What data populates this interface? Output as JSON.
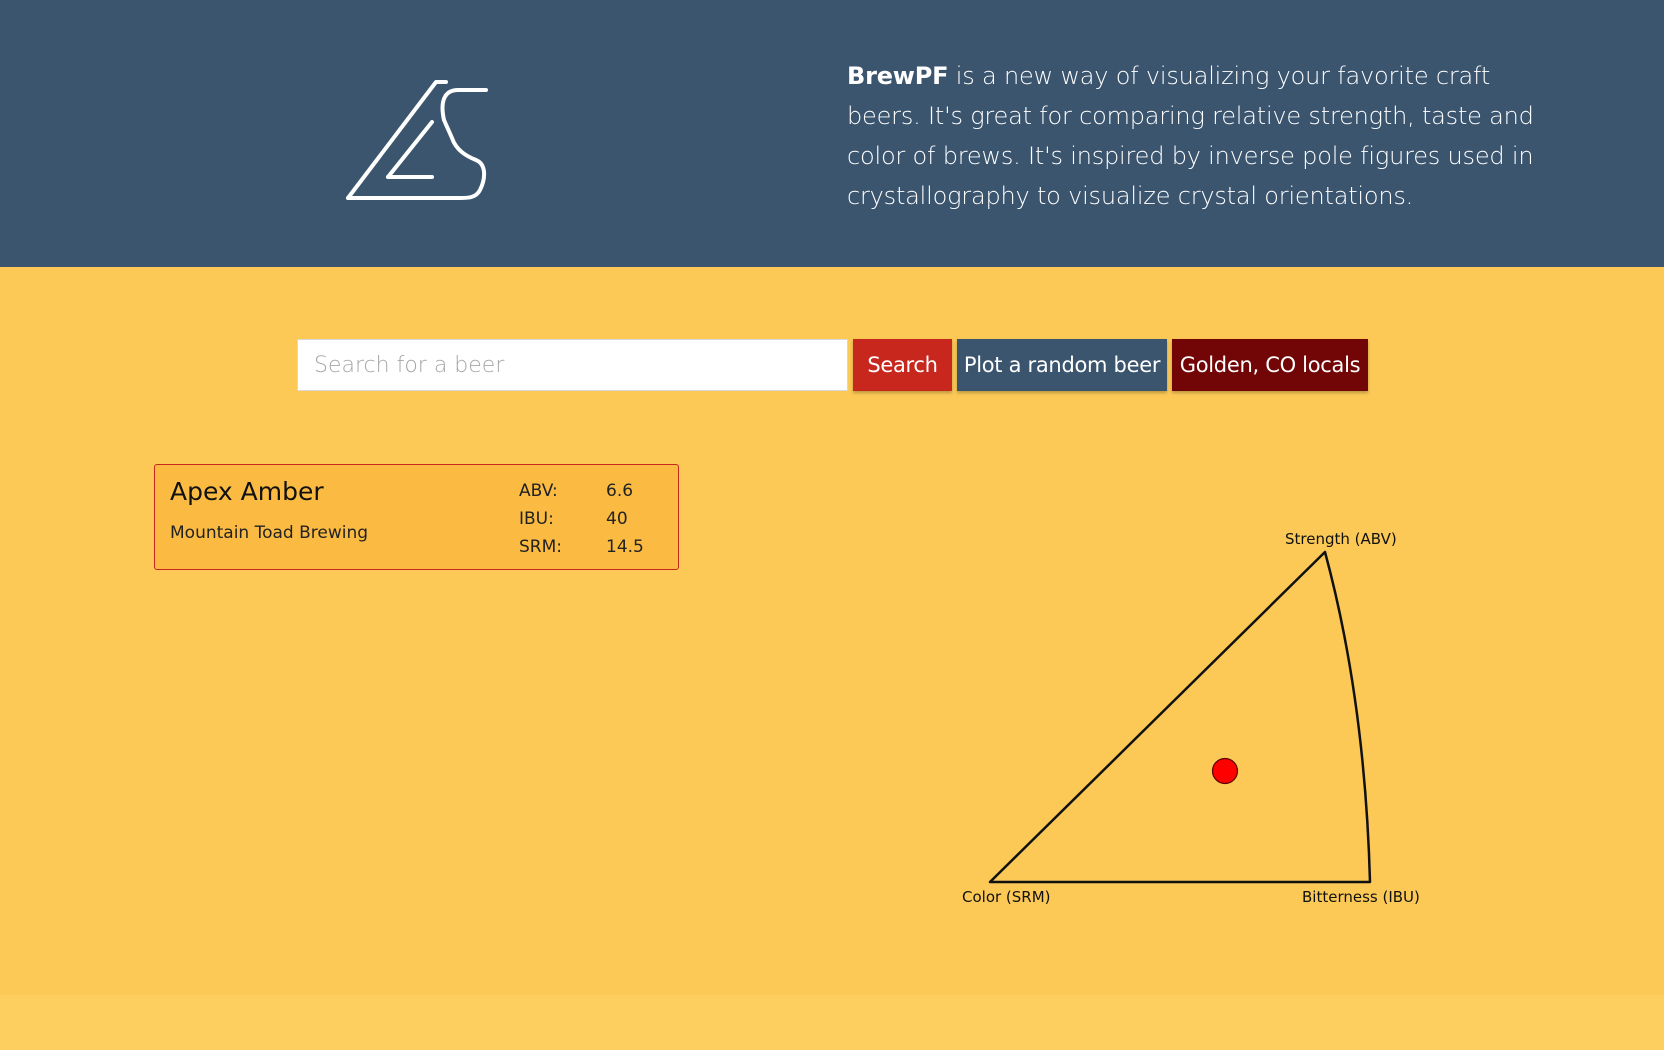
{
  "header": {
    "logo_name": "brewpf-logo",
    "intro": {
      "brand": "BrewPF",
      "text": " is a new way of visualizing your favorite craft beers. It's great for comparing relative strength, taste and color of brews. It's inspired by inverse pole figures used in crystallography to visualize crystal orientations."
    }
  },
  "search": {
    "placeholder": "Search for a beer",
    "value": "",
    "search_label": "Search",
    "random_label": "Plot a random beer",
    "locals_label": "Golden, CO locals"
  },
  "beer": {
    "name": "Apex Amber",
    "brewery": "Mountain Toad Brewing",
    "stats": [
      {
        "key": "ABV:",
        "value": "6.6"
      },
      {
        "key": "IBU:",
        "value": "40"
      },
      {
        "key": "SRM:",
        "value": "14.5"
      }
    ]
  },
  "plot": {
    "labels": {
      "top": "Strength (ABV)",
      "left": "Color (SRM)",
      "right": "Bitterness (IBU)"
    },
    "point": {
      "abv": 6.6,
      "ibu": 40,
      "srm": 14.5
    }
  },
  "colors": {
    "header_bg": "#3b556f",
    "page_bg": "#fcc957",
    "search_button": "#c8271e",
    "random_button": "#3b556f",
    "locals_button": "#720607",
    "card_bg": "#fbbb43",
    "card_border": "#c8271e",
    "point_fill": "#ff0000"
  }
}
